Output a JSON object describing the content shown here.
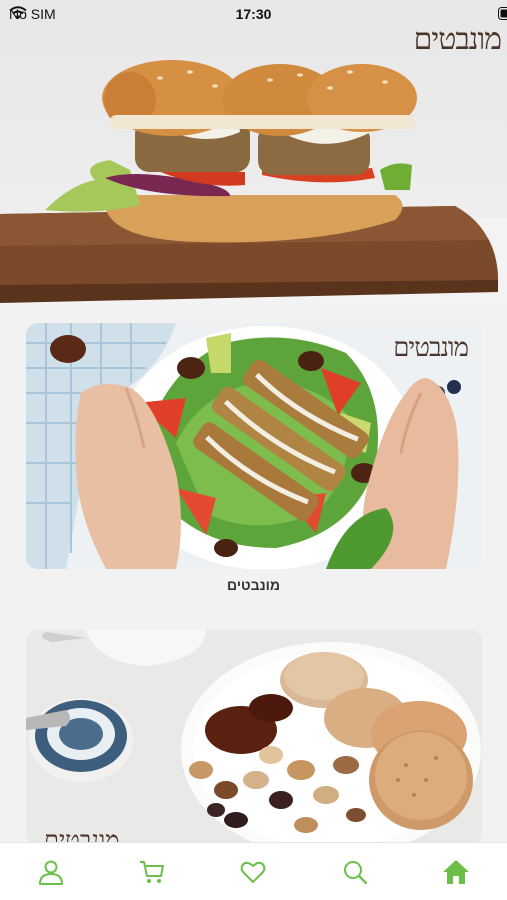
{
  "status_bar": {
    "carrier": "No SIM",
    "time": "17:30"
  },
  "brand": {
    "logo_text": "מונבטים"
  },
  "feed": [
    {
      "logo_text": "מונבטים",
      "caption": "מונבטים"
    },
    {
      "logo_text": "מונבטים"
    }
  ],
  "tab_bar": {
    "items": [
      {
        "icon": "user-icon"
      },
      {
        "icon": "cart-icon"
      },
      {
        "icon": "heart-icon"
      },
      {
        "icon": "search-icon"
      },
      {
        "icon": "home-icon",
        "active": true
      }
    ],
    "accent_color": "#6cc04a"
  }
}
